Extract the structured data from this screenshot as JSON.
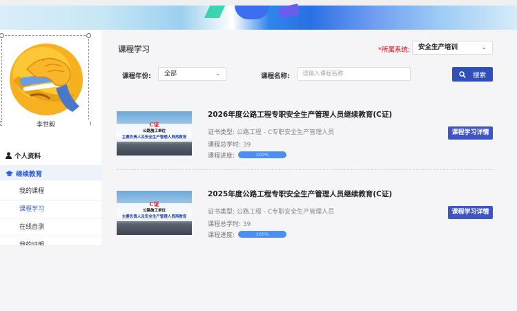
{
  "user": {
    "name": "李世毅"
  },
  "sidebar": {
    "personal": "个人资料",
    "continuing_edu": "继续教育",
    "items": [
      {
        "label": "我的课程"
      },
      {
        "label": "课程学习"
      },
      {
        "label": "在线自测"
      },
      {
        "label": "我的证明"
      }
    ]
  },
  "main": {
    "title": "课程学习",
    "system_label_req": "*",
    "system_label": "所属系统:",
    "system_value": "安全生产培训",
    "filters": {
      "year_label": "课程年份:",
      "year_value": "全部",
      "name_label": "课程名称:",
      "name_placeholder": "请输入课程名称",
      "search_button": "搜索"
    },
    "courses": [
      {
        "title": "2026年度公路工程专职安全生产管理人员继续教育(C证)",
        "cert_label": "证书类型:",
        "cert_value": "公路工程 - C专职安全生产管理人员",
        "hours_label": "课程总学时:",
        "hours_value": "39",
        "progress_label": "课程进度:",
        "progress_value": "100%",
        "progress": 1.0,
        "detail_button": "课程学习详情",
        "thumb_red": "C证",
        "thumb_l1": "公路施工单位",
        "thumb_l2": "主要负责人及安全生产管理人员再教育"
      },
      {
        "title": "2025年度公路工程专职安全生产管理人员继续教育(C证)",
        "cert_label": "证书类型:",
        "cert_value": "公路工程 - C专职安全生产管理人员",
        "hours_label": "课程总学时:",
        "hours_value": "39",
        "progress_label": "课程进度:",
        "progress_value": "100%",
        "progress": 1.0,
        "detail_button": "课程学习详情",
        "thumb_red": "C证",
        "thumb_l1": "公路施工单位",
        "thumb_l2": "主要负责人及安全生产管理人员再教育"
      }
    ]
  },
  "colors": {
    "accent": "#2f50b8",
    "link": "#2e5bd7",
    "progress": "#4c8ff1",
    "required": "#e60012"
  }
}
